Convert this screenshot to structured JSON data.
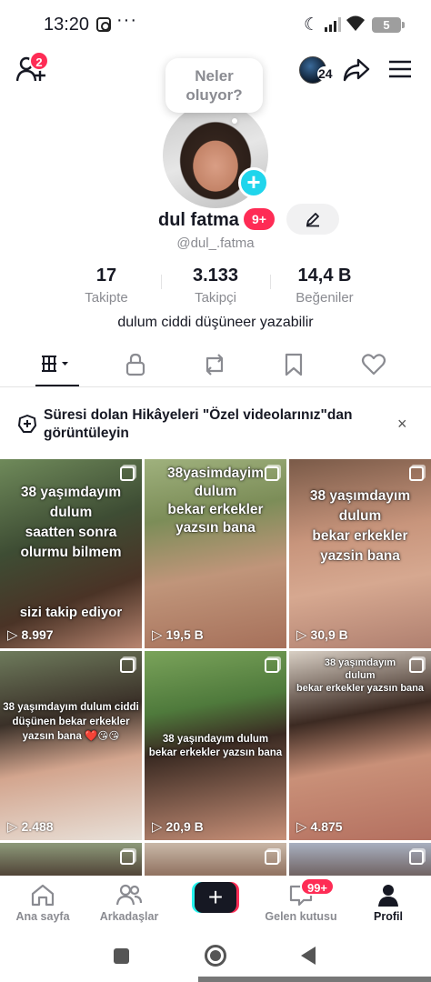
{
  "status_bar": {
    "time": "13:20",
    "battery": "5"
  },
  "header": {
    "friend_requests_badge": "2",
    "account_count": "24"
  },
  "profile": {
    "status_bubble": "Neler oluyor?",
    "display_name": "dul fatma",
    "name_badge": "9+",
    "username": "@dul_.fatma",
    "bio": "dulum ciddi düşüneer yazabilir",
    "stats": [
      {
        "value": "17",
        "label": "Takipte"
      },
      {
        "value": "3.133",
        "label": "Takipçi"
      },
      {
        "value": "14,4 B",
        "label": "Beğeniler"
      }
    ]
  },
  "tabs": [
    {
      "icon": "grid-icon",
      "active": true
    },
    {
      "icon": "lock-icon"
    },
    {
      "icon": "repost-icon"
    },
    {
      "icon": "bookmark-icon"
    },
    {
      "icon": "heart-icon"
    }
  ],
  "banner": {
    "text": "Süresi dolan Hikâyeleri \"Özel videolarınız\"dan görüntüleyin",
    "close": "×"
  },
  "videos": [
    {
      "caption": "38 yaşımdayım\ndulum\nsaatten sonra\nolurmu bilmem",
      "caption2": "sizi takip ediyor",
      "views": "8.997"
    },
    {
      "caption": "38yasimdayim\ndulum\nbekar erkekler\nyazsın bana",
      "views": "19,5 B"
    },
    {
      "caption": "38 yaşımdayım\ndulum\nbekar erkekler\nyazsin bana",
      "views": "30,9 B"
    },
    {
      "caption": "38 yaşımdayım dulum ciddi\ndüşünen bekar erkekler\nyazsın bana ❤️😘😘",
      "views": "2.488"
    },
    {
      "caption": "38 yaşındayım dulum\nbekar erkekler yazsın bana",
      "views": "20,9 B"
    },
    {
      "caption": "38 yaşımdayım\ndulum\nbekar erkekler yazsın bana",
      "views": "4.875"
    }
  ],
  "bottom_nav": {
    "home": "Ana sayfa",
    "friends": "Arkadaşlar",
    "create": "+",
    "inbox": "Gelen kutusu",
    "inbox_badge": "99+",
    "profile": "Profil"
  },
  "colors": {
    "accent": "#fe2c55",
    "cyan": "#20d5ec",
    "text": "#161823",
    "muted": "#8a8b91"
  }
}
